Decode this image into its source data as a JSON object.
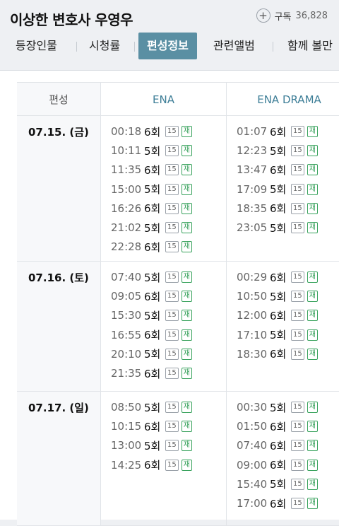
{
  "header": {
    "title": "이상한 변호사 우영우",
    "subscribe_label": "구독",
    "subscribe_count": "36,828",
    "plus_symbol": "+"
  },
  "tabs": [
    "등장인물",
    "시청률",
    "편성정보",
    "관련앨범",
    "함께 볼만"
  ],
  "active_tab": "편성정보",
  "table": {
    "headers": {
      "label": "편성",
      "ena": "ENA",
      "drama": "ENA DRAMA"
    },
    "rating_badge": "15",
    "rerun_badge": "재",
    "days": [
      {
        "date": "07.15. (금)",
        "ena": [
          {
            "time": "00:18",
            "ep": "6회"
          },
          {
            "time": "10:11",
            "ep": "5회"
          },
          {
            "time": "11:35",
            "ep": "6회"
          },
          {
            "time": "15:00",
            "ep": "5회"
          },
          {
            "time": "16:26",
            "ep": "6회"
          },
          {
            "time": "21:02",
            "ep": "5회"
          },
          {
            "time": "22:28",
            "ep": "6회"
          }
        ],
        "drama": [
          {
            "time": "01:07",
            "ep": "6회"
          },
          {
            "time": "12:23",
            "ep": "5회"
          },
          {
            "time": "13:47",
            "ep": "6회"
          },
          {
            "time": "17:09",
            "ep": "5회"
          },
          {
            "time": "18:35",
            "ep": "6회"
          },
          {
            "time": "23:05",
            "ep": "5회"
          }
        ]
      },
      {
        "date": "07.16. (토)",
        "ena": [
          {
            "time": "07:40",
            "ep": "5회"
          },
          {
            "time": "09:05",
            "ep": "6회"
          },
          {
            "time": "15:30",
            "ep": "5회"
          },
          {
            "time": "16:55",
            "ep": "6회"
          },
          {
            "time": "20:10",
            "ep": "5회"
          },
          {
            "time": "21:35",
            "ep": "6회"
          }
        ],
        "drama": [
          {
            "time": "00:29",
            "ep": "6회"
          },
          {
            "time": "10:50",
            "ep": "5회"
          },
          {
            "time": "12:00",
            "ep": "6회"
          },
          {
            "time": "17:10",
            "ep": "5회"
          },
          {
            "time": "18:30",
            "ep": "6회"
          }
        ]
      },
      {
        "date": "07.17. (일)",
        "ena": [
          {
            "time": "08:50",
            "ep": "5회"
          },
          {
            "time": "10:15",
            "ep": "6회"
          },
          {
            "time": "13:00",
            "ep": "5회"
          },
          {
            "time": "14:25",
            "ep": "6회"
          }
        ],
        "drama": [
          {
            "time": "00:30",
            "ep": "5회"
          },
          {
            "time": "01:50",
            "ep": "6회"
          },
          {
            "time": "07:40",
            "ep": "6회"
          },
          {
            "time": "09:00",
            "ep": "6회"
          },
          {
            "time": "15:40",
            "ep": "5회"
          },
          {
            "time": "17:00",
            "ep": "6회"
          }
        ]
      }
    ]
  },
  "colors": {
    "accent": "#5a8fa3",
    "channel_header": "#3f7f98",
    "rerun_green": "#3aa35e"
  }
}
